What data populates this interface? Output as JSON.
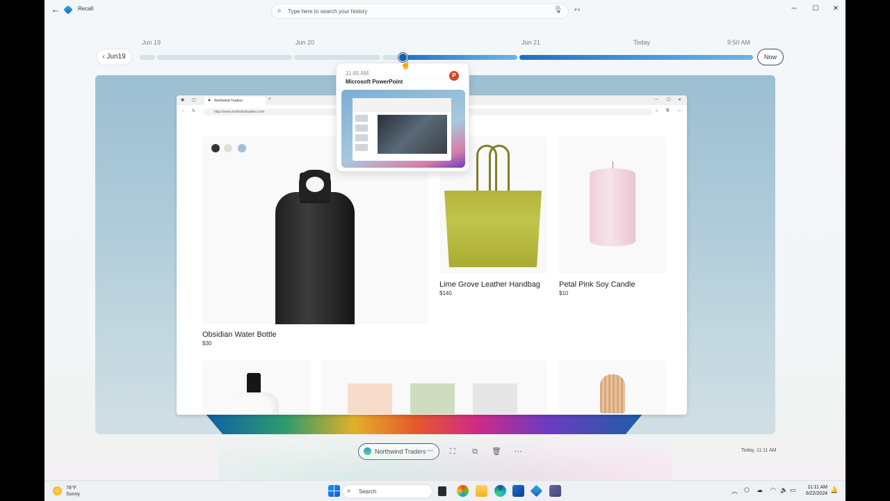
{
  "app": {
    "title": "Recall",
    "search_placeholder": "Type here to search your history",
    "window_controls": {
      "minimize": "─",
      "maximize": "☐",
      "close": "✕"
    }
  },
  "timeline": {
    "back_label": "Jun19",
    "now_label": "Now",
    "dates": [
      "Jun 19",
      "Jun 20",
      "Jun 21",
      "Today",
      "9:50 AM"
    ],
    "popup": {
      "time": "11:45 AM",
      "app": "Microsoft PowerPoint",
      "app_icon": "P"
    }
  },
  "browser": {
    "tab_title": "Northwind Traders",
    "url": "http://www.northwindtraders.com"
  },
  "products": [
    {
      "name": "Obsidian  Water Bottle",
      "price": "$30"
    },
    {
      "name": "Lime Grove Leather Handbag",
      "price": "$140"
    },
    {
      "name": "Petal Pink Soy Candle",
      "price": "$10"
    }
  ],
  "swatches": [
    "#333333",
    "#e2e0d4",
    "#9fbfd9"
  ],
  "actions": {
    "source_label": "Northwind Traders",
    "snapshot_time": "Today, 11:11 AM"
  },
  "taskbar": {
    "weather_temp": "78°F",
    "weather_desc": "Sunny",
    "search_label": "Search",
    "time": "11:11 AM",
    "date": "6/22/2024"
  }
}
